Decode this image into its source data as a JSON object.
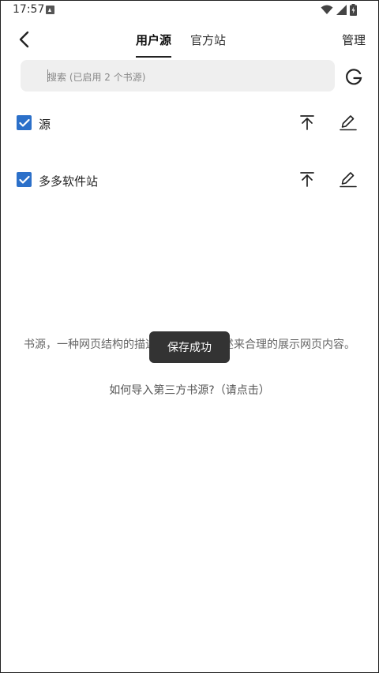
{
  "status_bar": {
    "time": "17:57",
    "icons": [
      "notification-icon",
      "wifi-icon",
      "signal-icon",
      "battery-icon"
    ]
  },
  "toolbar": {
    "back_icon": "back-arrow-icon",
    "tabs": [
      {
        "label": "用户源",
        "active": true
      },
      {
        "label": "官方站",
        "active": false
      }
    ],
    "manage_label": "管理"
  },
  "search": {
    "placeholder": "搜索 (已启用 2 个书源)",
    "google_icon": "google-icon"
  },
  "sources": [
    {
      "name": "源",
      "checked": true
    },
    {
      "name": "多多软件站",
      "checked": true
    }
  ],
  "empty_state": {
    "description": "书源，一种网页结构的描述规则，通过描述来合理的展示网页内容。",
    "help_link": "如何导入第三方书源?（请点击）"
  },
  "toast": {
    "message": "保存成功"
  },
  "colors": {
    "checkbox": "#2c70c9",
    "toast_bg": "#333333",
    "search_bg": "#efefef"
  }
}
